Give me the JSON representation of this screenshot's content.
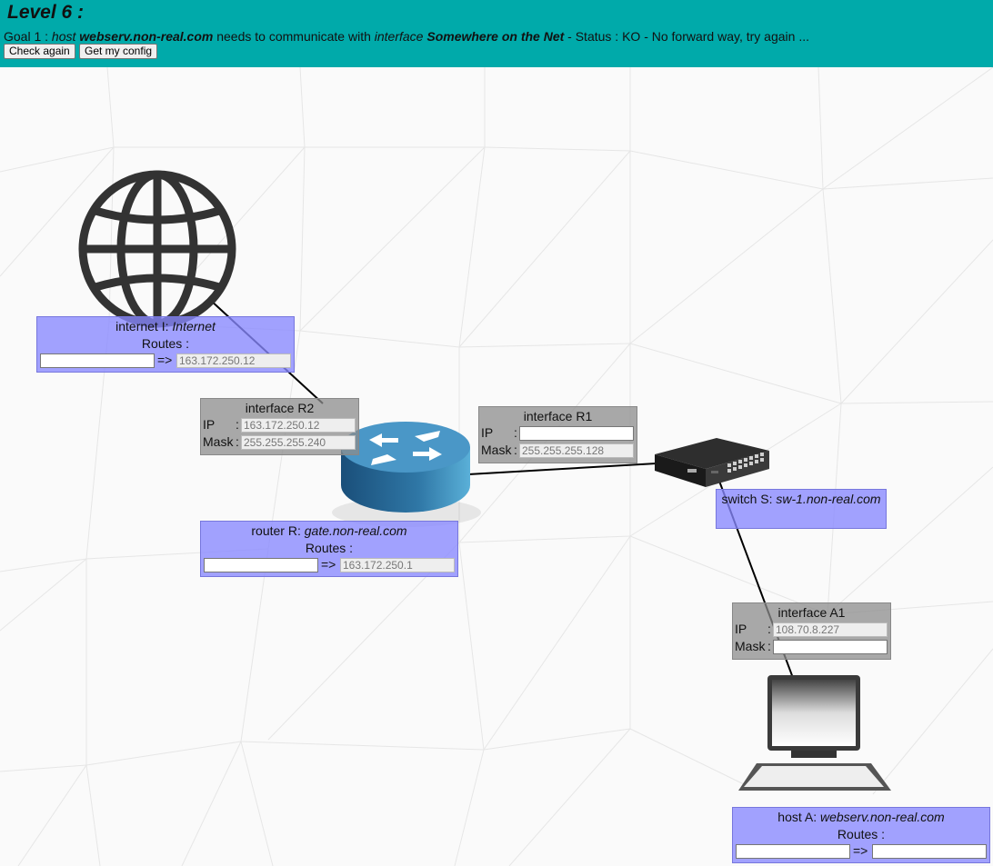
{
  "header": {
    "title": "Level 6 :",
    "goal_prefix": "Goal 1 : ",
    "goal_host_word": "host",
    "goal_host_name": "webserv.non-real.com",
    "goal_mid": " needs to communicate with ",
    "goal_iface_word": "interface",
    "goal_iface_name": "Somewhere on the Net",
    "goal_status": " - Status : KO - No forward way, try again ...",
    "check_again": "Check again",
    "get_config": "Get my config"
  },
  "colors": {
    "header_bg": "#00aaaa",
    "node_panel": "#8888ff",
    "interface_panel": "#8c8c8c"
  },
  "internet": {
    "icon": "globe-icon",
    "title_prefix": "internet I: ",
    "name": "Internet",
    "routes_label": "Routes :",
    "arrow": "=>",
    "route_dest": "",
    "route_gateway": "163.172.250.12"
  },
  "iface_r2": {
    "title": "interface R2",
    "ip_label": "IP",
    "mask_label": "Mask",
    "colon": ":",
    "ip": "163.172.250.12",
    "mask": "255.255.255.240"
  },
  "iface_r1": {
    "title": "interface R1",
    "ip_label": "IP",
    "mask_label": "Mask",
    "colon": ":",
    "ip": "",
    "mask": "255.255.255.128"
  },
  "router": {
    "icon": "router-icon",
    "title_prefix": "router R: ",
    "name": "gate.non-real.com",
    "routes_label": "Routes :",
    "arrow": "=>",
    "route_dest": "",
    "route_gateway": "163.172.250.1"
  },
  "switch": {
    "icon": "switch-icon",
    "title_prefix": "switch S: ",
    "name": "sw-1.non-real.com"
  },
  "iface_a1": {
    "title": "interface A1",
    "ip_label": "IP",
    "mask_label": "Mask",
    "colon": ":",
    "ip": "108.70.8.227",
    "mask": ""
  },
  "host": {
    "icon": "laptop-icon",
    "title_prefix": "host A: ",
    "name": "webserv.non-real.com",
    "routes_label": "Routes :",
    "arrow": "=>",
    "route_dest": "",
    "route_gateway": ""
  }
}
